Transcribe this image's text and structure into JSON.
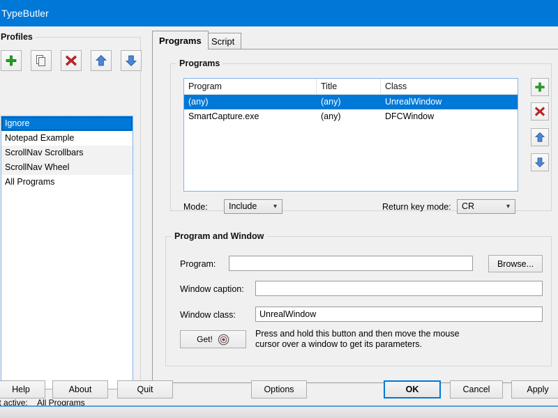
{
  "window": {
    "title": "TypeButler"
  },
  "profiles": {
    "group_label": "Profiles",
    "toolbar": [
      {
        "name": "add-profile-button",
        "icon": "plus-icon"
      },
      {
        "name": "duplicate-profile-button",
        "icon": "copy-icon"
      },
      {
        "name": "delete-profile-button",
        "icon": "delete-x-icon"
      },
      {
        "name": "move-profile-up-button",
        "icon": "arrow-up-icon"
      },
      {
        "name": "move-profile-down-button",
        "icon": "arrow-down-icon"
      }
    ],
    "items": [
      {
        "label": "Ignore",
        "selected": true
      },
      {
        "label": "Notepad Example",
        "selected": false
      },
      {
        "label": "ScrollNav Scrollbars",
        "selected": false
      },
      {
        "label": "ScrollNav Wheel",
        "selected": false
      },
      {
        "label": "All Programs",
        "selected": false
      }
    ],
    "last_active_label": "Last active:",
    "last_active_value": "All Programs"
  },
  "tabs": [
    {
      "label": "Programs",
      "active": true
    },
    {
      "label": "Script",
      "active": false
    }
  ],
  "programs": {
    "group_label": "Programs",
    "columns": [
      "Program",
      "Title",
      "Class"
    ],
    "rows": [
      {
        "program": "(any)",
        "title": "(any)",
        "class": "UnrealWindow",
        "selected": true
      },
      {
        "program": "SmartCapture.exe",
        "title": "(any)",
        "class": "DFCWindow",
        "selected": false
      }
    ],
    "side_buttons": [
      {
        "name": "add-program-button",
        "icon": "plus-icon"
      },
      {
        "name": "delete-program-button",
        "icon": "delete-x-icon"
      },
      {
        "name": "move-program-up-button",
        "icon": "arrow-up-icon"
      },
      {
        "name": "move-program-down-button",
        "icon": "arrow-down-icon"
      }
    ],
    "mode_label": "Mode:",
    "mode_value": "Include",
    "return_key_label": "Return key mode:",
    "return_key_value": "CR"
  },
  "program_and_window": {
    "group_label": "Program and Window",
    "program_label": "Program:",
    "program_value": "",
    "program_placeholder": "",
    "browse_label": "Browse...",
    "caption_label": "Window caption:",
    "caption_value": "",
    "caption_placeholder": "",
    "class_label": "Window class:",
    "class_value": "UnrealWindow",
    "class_placeholder": "",
    "get_label": "Get!",
    "hint_line1": "Press and hold this button and then move the mouse",
    "hint_line2": "cursor over a window to get its parameters."
  },
  "footer": {
    "help": "Help",
    "about": "About",
    "quit": "Quit",
    "options": "Options",
    "ok": "OK",
    "cancel": "Cancel",
    "apply": "Apply"
  },
  "colors": {
    "title_bar": "#0078d7",
    "selection": "#0078d7",
    "accent_border": "#7eb4ea",
    "group_border": "#d5d5d5",
    "icon_green": "#21a121",
    "icon_red": "#cc2222",
    "icon_blue": "#3f7fd0",
    "bottom_rule": "#5b9bd5"
  }
}
